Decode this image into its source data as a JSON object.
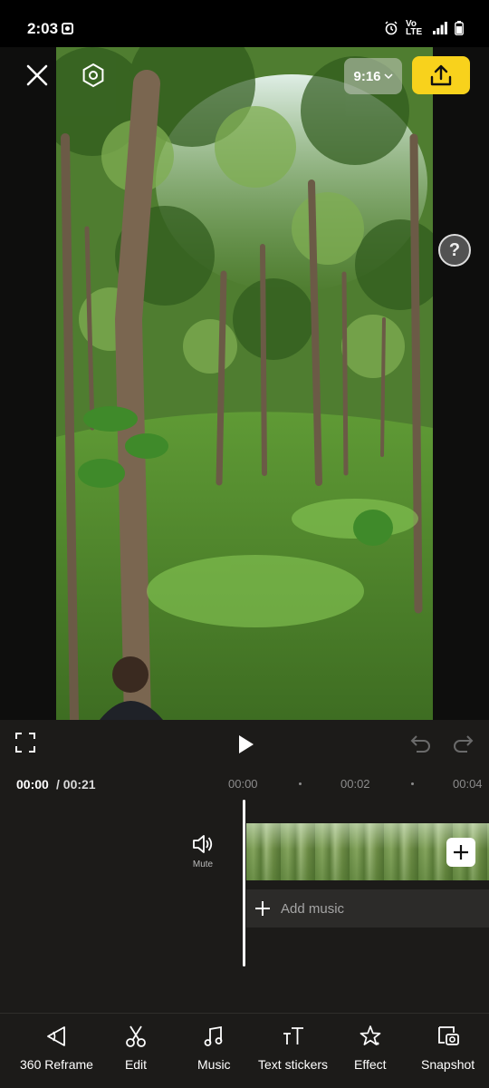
{
  "status_bar": {
    "time": "2:03",
    "network": "Vo LTE"
  },
  "preview": {
    "aspect_ratio": "9:16",
    "help": "?"
  },
  "playback": {
    "current_time": "00:00",
    "total_time": "/ 00:21"
  },
  "ruler": {
    "ticks": [
      "00:00",
      "00:02",
      "00:04"
    ]
  },
  "timeline": {
    "mute_label": "Mute",
    "add_music_label": "Add music"
  },
  "toolbar": {
    "items": [
      {
        "label": "360 Reframe",
        "icon": "reframe-360-icon"
      },
      {
        "label": "Edit",
        "icon": "scissors-icon"
      },
      {
        "label": "Music",
        "icon": "music-note-icon"
      },
      {
        "label": "Text stickers",
        "icon": "text-icon"
      },
      {
        "label": "Effect",
        "icon": "sparkle-star-icon"
      },
      {
        "label": "Snapshot",
        "icon": "camera-snapshot-icon"
      }
    ]
  },
  "colors": {
    "accent": "#f8d21c",
    "background": "#1c1b19"
  }
}
